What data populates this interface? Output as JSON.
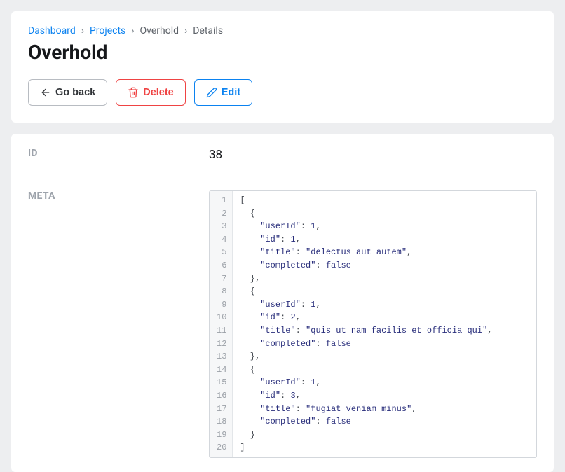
{
  "breadcrumb": {
    "dashboard": "Dashboard",
    "projects": "Projects",
    "project": "Overhold",
    "details": "Details"
  },
  "title": "Overhold",
  "buttons": {
    "go_back": "Go back",
    "delete": "Delete",
    "edit": "Edit"
  },
  "fields": {
    "id_label": "ID",
    "id_value": "38",
    "meta_label": "META",
    "meta_value": [
      {
        "userId": 1,
        "id": 1,
        "title": "delectus aut autem",
        "completed": false
      },
      {
        "userId": 1,
        "id": 2,
        "title": "quis ut nam facilis et officia qui",
        "completed": false
      },
      {
        "userId": 1,
        "id": 3,
        "title": "fugiat veniam minus",
        "completed": false
      }
    ]
  }
}
